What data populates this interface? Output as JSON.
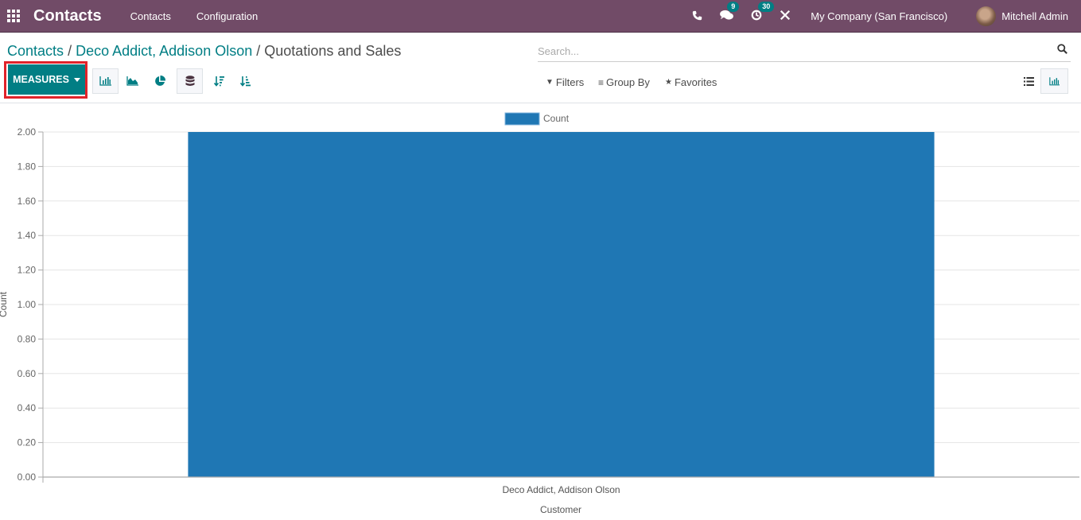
{
  "navbar": {
    "app_title": "Contacts",
    "menu": [
      "Contacts",
      "Configuration"
    ],
    "messages_badge": "9",
    "activities_badge": "30",
    "company": "My Company (San Francisco)",
    "user": "Mitchell Admin"
  },
  "breadcrumb": {
    "items": [
      "Contacts",
      "Deco Addict, Addison Olson"
    ],
    "separator": "/",
    "current": "Quotations and Sales"
  },
  "search": {
    "placeholder": "Search..."
  },
  "toolbar": {
    "measures_label": "MEASURES",
    "filters_label": "Filters",
    "group_by_label": "Group By",
    "favorites_label": "Favorites"
  },
  "colors": {
    "navbar": "#714b67",
    "primary": "#017e84",
    "bar": "#1f77b4",
    "highlight": "#e0232a"
  },
  "chart_data": {
    "type": "bar",
    "categories": [
      "Deco Addict, Addison Olson"
    ],
    "series": [
      {
        "name": "Count",
        "values": [
          2
        ]
      }
    ],
    "title": "",
    "xlabel": "Customer",
    "ylabel": "Count",
    "ylim": [
      0,
      2
    ],
    "yticks": [
      "0.00",
      "0.20",
      "0.40",
      "0.60",
      "0.80",
      "1.00",
      "1.20",
      "1.40",
      "1.60",
      "1.80",
      "2.00"
    ],
    "grid": true,
    "legend": "top-center"
  }
}
